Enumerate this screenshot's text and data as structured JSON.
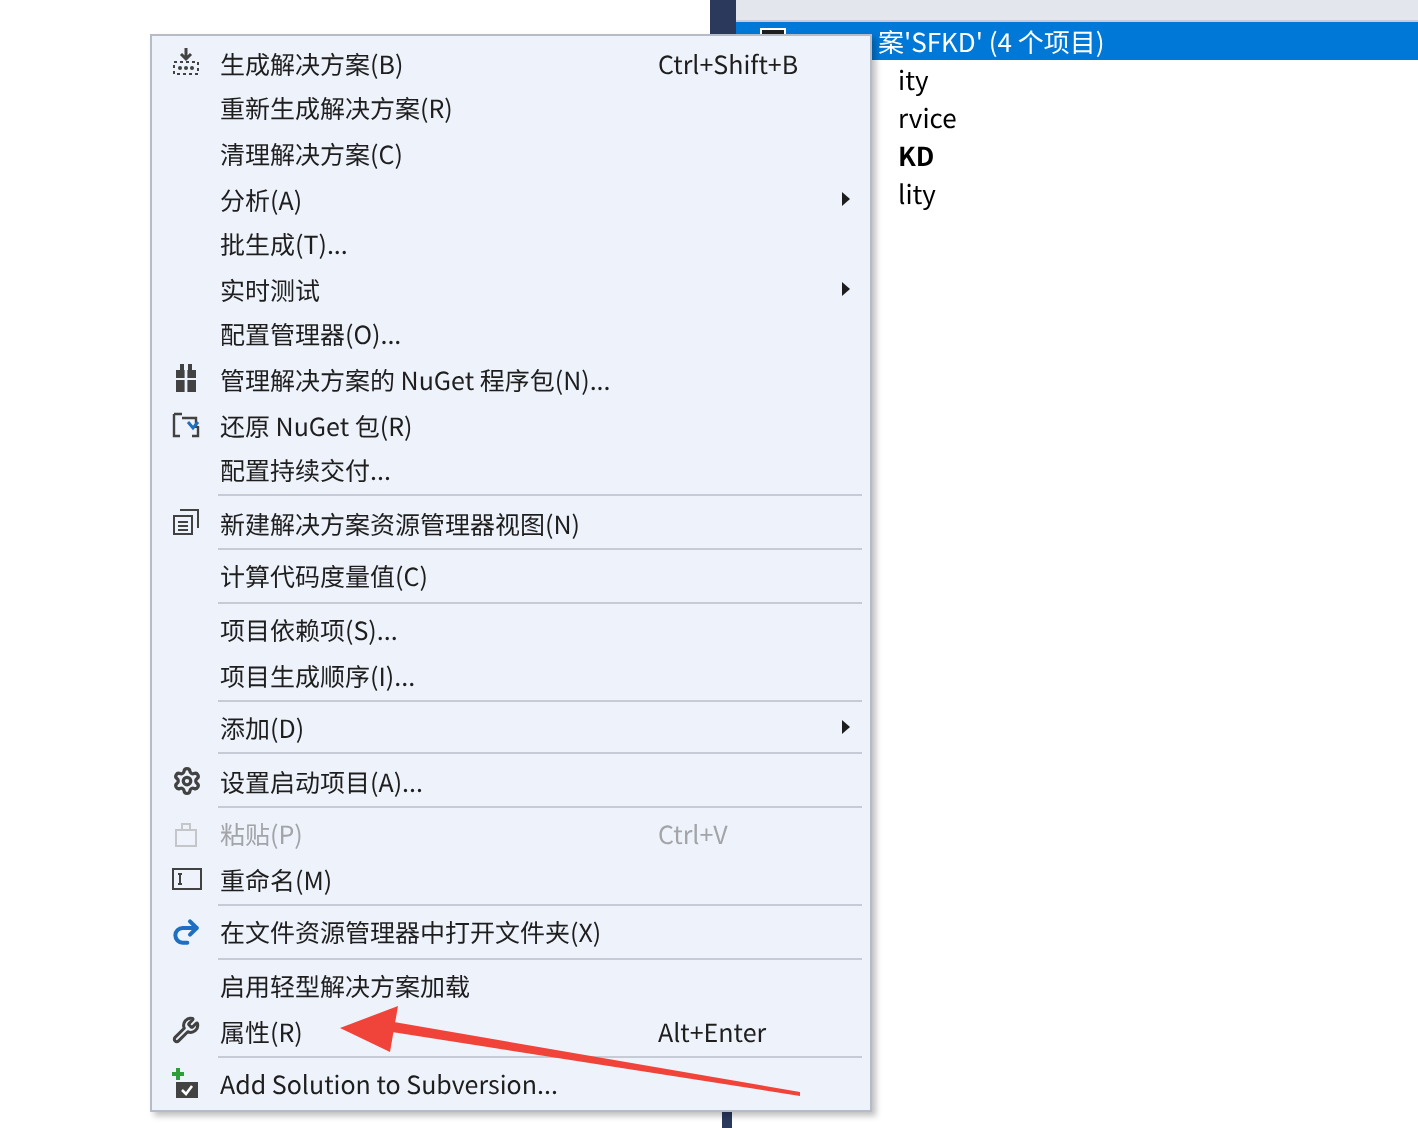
{
  "solution_tree": {
    "rows": [
      {
        "text": "案'SFKD' (4 个项目)",
        "selected": true,
        "bold": false
      },
      {
        "text": "ity",
        "selected": false,
        "bold": false
      },
      {
        "text": "rvice",
        "selected": false,
        "bold": false
      },
      {
        "text": "KD",
        "selected": false,
        "bold": true
      },
      {
        "text": "lity",
        "selected": false,
        "bold": false
      }
    ]
  },
  "context_menu": {
    "groups": [
      [
        {
          "label": "生成解决方案(B)",
          "shortcut": "Ctrl+Shift+B",
          "submenu": false,
          "disabled": false
        },
        {
          "label": "重新生成解决方案(R)",
          "submenu": false,
          "disabled": false
        },
        {
          "label": "清理解决方案(C)",
          "submenu": false,
          "disabled": false
        },
        {
          "label": "分析(A)",
          "submenu": true,
          "disabled": false
        },
        {
          "label": "批生成(T)...",
          "submenu": false,
          "disabled": false
        },
        {
          "label": "实时测试",
          "submenu": true,
          "disabled": false
        },
        {
          "label": "配置管理器(O)...",
          "submenu": false,
          "disabled": false
        },
        {
          "label": "管理解决方案的 NuGet 程序包(N)...",
          "submenu": false,
          "disabled": false
        },
        {
          "label": "还原 NuGet 包(R)",
          "submenu": false,
          "disabled": false
        },
        {
          "label": "配置持续交付...",
          "submenu": false,
          "disabled": false
        }
      ],
      [
        {
          "label": "新建解决方案资源管理器视图(N)",
          "submenu": false,
          "disabled": false
        }
      ],
      [
        {
          "label": "计算代码度量值(C)",
          "submenu": false,
          "disabled": false
        }
      ],
      [
        {
          "label": "项目依赖项(S)...",
          "submenu": false,
          "disabled": false
        },
        {
          "label": "项目生成顺序(I)...",
          "submenu": false,
          "disabled": false
        }
      ],
      [
        {
          "label": "添加(D)",
          "submenu": true,
          "disabled": false
        }
      ],
      [
        {
          "label": "设置启动项目(A)...",
          "submenu": false,
          "disabled": false
        }
      ],
      [
        {
          "label": "粘贴(P)",
          "shortcut": "Ctrl+V",
          "submenu": false,
          "disabled": true
        },
        {
          "label": "重命名(M)",
          "submenu": false,
          "disabled": false
        }
      ],
      [
        {
          "label": "在文件资源管理器中打开文件夹(X)",
          "submenu": false,
          "disabled": false
        }
      ],
      [
        {
          "label": "启用轻型解决方案加载",
          "submenu": false,
          "disabled": false
        },
        {
          "label": "属性(R)",
          "shortcut": "Alt+Enter",
          "submenu": false,
          "disabled": false
        }
      ],
      [
        {
          "label": "Add Solution to Subversion...",
          "submenu": false,
          "disabled": false
        }
      ]
    ]
  }
}
